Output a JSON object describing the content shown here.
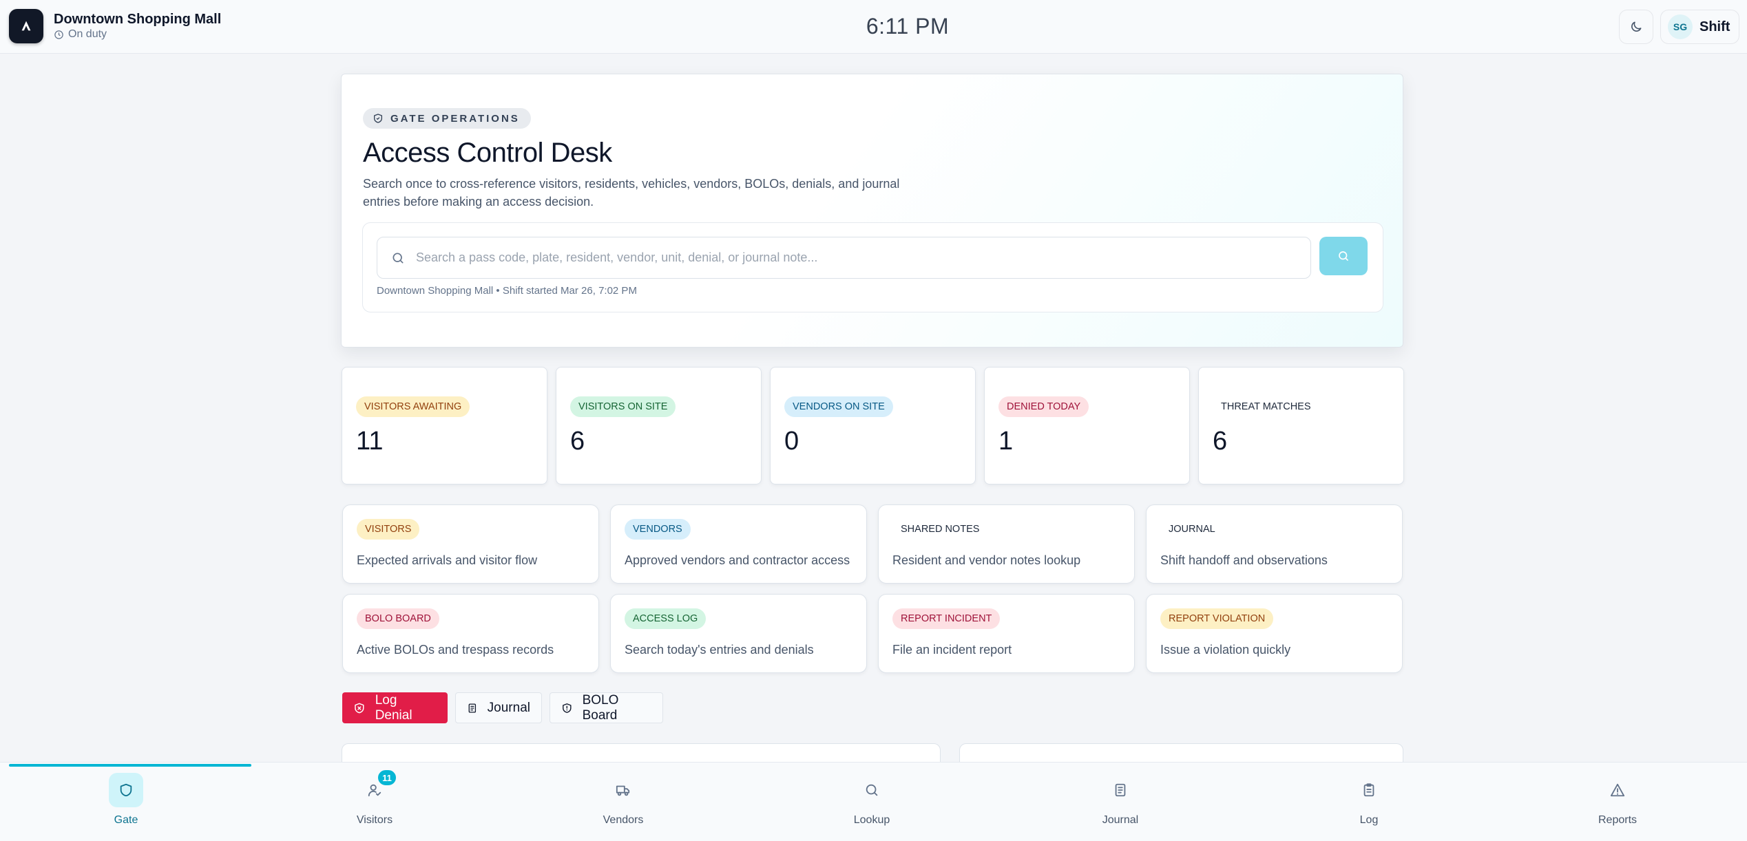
{
  "header": {
    "site_name": "Downtown Shopping Mall",
    "status": "On duty",
    "clock": "6:11 PM",
    "user_initials": "SG",
    "user_label": "Shift"
  },
  "hero": {
    "pill": "GATE OPERATIONS",
    "title": "Access Control Desk",
    "description": "Search once to cross-reference visitors, residents, vehicles, vendors, BOLOs, denials, and journal entries before making an access decision.",
    "search_placeholder": "Search a pass code, plate, resident, vendor, unit, denial, or journal note...",
    "search_value": "",
    "meta": "Downtown Shopping Mall • Shift started Mar 26, 7:02 PM"
  },
  "stats": [
    {
      "label": "VISITORS AWAITING",
      "value": "11"
    },
    {
      "label": "VISITORS ON SITE",
      "value": "6"
    },
    {
      "label": "VENDORS ON SITE",
      "value": "0"
    },
    {
      "label": "DENIED TODAY",
      "value": "1"
    },
    {
      "label": "THREAT MATCHES",
      "value": "6"
    }
  ],
  "tiles": [
    {
      "label": "VISITORS",
      "desc": "Expected arrivals and visitor flow"
    },
    {
      "label": "VENDORS",
      "desc": "Approved vendors and contractor access"
    },
    {
      "label": "SHARED NOTES",
      "desc": "Resident and vendor notes lookup"
    },
    {
      "label": "JOURNAL",
      "desc": "Shift handoff and observations"
    },
    {
      "label": "BOLO BOARD",
      "desc": "Active BOLOs and trespass records"
    },
    {
      "label": "ACCESS LOG",
      "desc": "Search today's entries and denials"
    },
    {
      "label": "REPORT INCIDENT",
      "desc": "File an incident report"
    },
    {
      "label": "REPORT VIOLATION",
      "desc": "Issue a violation quickly"
    }
  ],
  "actions": {
    "log_denial": "Log Denial",
    "journal": "Journal",
    "bolo_board": "BOLO Board"
  },
  "nav": {
    "progress": 0.14,
    "items": [
      {
        "label": "Gate",
        "icon": "shield-icon",
        "active": true
      },
      {
        "label": "Visitors",
        "icon": "user-check-icon",
        "badge": "11"
      },
      {
        "label": "Vendors",
        "icon": "truck-icon"
      },
      {
        "label": "Lookup",
        "icon": "search-icon"
      },
      {
        "label": "Journal",
        "icon": "book-icon"
      },
      {
        "label": "Log",
        "icon": "clipboard-icon"
      },
      {
        "label": "Reports",
        "icon": "alert-triangle-icon"
      }
    ]
  },
  "colors": {
    "accent": "#06b6d4",
    "danger": "#e11d48",
    "search_button": "#7fd8ea"
  }
}
